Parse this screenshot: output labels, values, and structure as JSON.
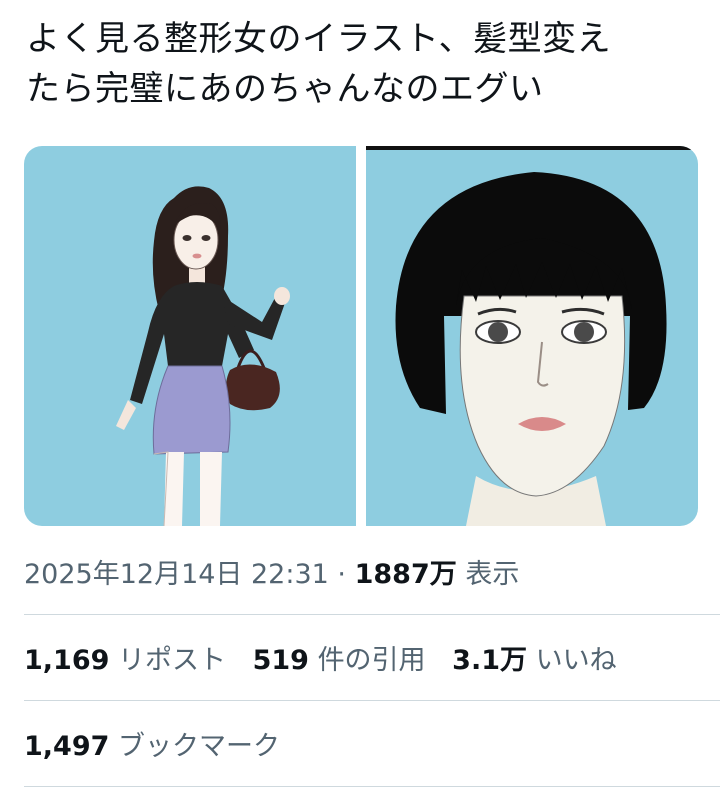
{
  "tweet": {
    "text_line1": "よく見る整形女のイラスト、髪型変え",
    "text_line2": "たら完璧にあのちゃんなのエグい"
  },
  "media": {
    "images": [
      "illustration-woman-long-hair",
      "illustration-woman-bob-hair"
    ],
    "background_color": "#8ecde0"
  },
  "meta": {
    "date": "2025年12月14日 22:31",
    "separator": "·",
    "views_count": "1887万",
    "views_label": "表示"
  },
  "stats": {
    "reposts_count": "1,169",
    "reposts_label": "リポスト",
    "quotes_count": "519",
    "quotes_label": "件の引用",
    "likes_count": "3.1万",
    "likes_label": "いいね",
    "bookmarks_count": "1,497",
    "bookmarks_label": "ブックマーク"
  }
}
